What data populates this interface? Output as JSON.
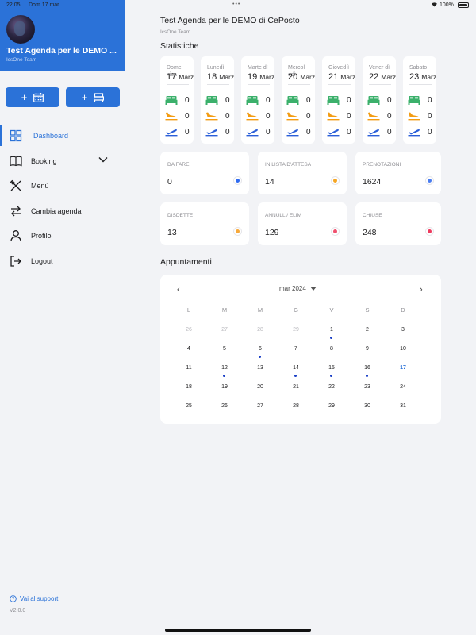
{
  "status_bar": {
    "time": "22:05",
    "date": "Dom 17 mar",
    "dots": "•••",
    "battery": "100%"
  },
  "sidebar": {
    "title": "Test Agenda per le DEMO ...",
    "subtitle": "IcsOne Team",
    "quick_actions": [
      {
        "label": "+",
        "icon": "calendar-icon"
      },
      {
        "label": "+",
        "icon": "bed-icon"
      }
    ],
    "items": [
      {
        "label": "Dashboard",
        "icon": "grid-icon",
        "active": true
      },
      {
        "label": "Booking",
        "icon": "book-icon"
      },
      {
        "label": "Menù",
        "icon": "utensils-icon"
      },
      {
        "label": "Cambia agenda",
        "icon": "swap-icon"
      },
      {
        "label": "Profilo",
        "icon": "user-icon"
      },
      {
        "label": "Logout",
        "icon": "logout-icon"
      }
    ],
    "support_label": "Vai al support",
    "version": "V2.0.0"
  },
  "main": {
    "title": "Test Agenda per le DEMO di CePosto",
    "subtitle": "IcsOne Team",
    "stats_heading": "Statistiche",
    "appointments_heading": "Appuntamenti"
  },
  "days": [
    {
      "name": "Dome nica",
      "day": "17",
      "month": "Marzo",
      "occupied": "0",
      "arrivals": "0",
      "departures": "0"
    },
    {
      "name": "Lunedì",
      "day": "18",
      "month": "Marzo",
      "occupied": "0",
      "arrivals": "0",
      "departures": "0"
    },
    {
      "name": "Marte dì",
      "day": "19",
      "month": "Marzo",
      "occupied": "0",
      "arrivals": "0",
      "departures": "0"
    },
    {
      "name": "Mercol edì",
      "day": "20",
      "month": "Marzo",
      "occupied": "0",
      "arrivals": "0",
      "departures": "0"
    },
    {
      "name": "Gioved ì",
      "day": "21",
      "month": "Marzo",
      "occupied": "0",
      "arrivals": "0",
      "departures": "0"
    },
    {
      "name": "Vener dì",
      "day": "22",
      "month": "Marzo",
      "occupied": "0",
      "arrivals": "0",
      "departures": "0"
    },
    {
      "name": "Sabato",
      "day": "23",
      "month": "Marzo",
      "occupied": "0",
      "arrivals": "0",
      "departures": "0"
    }
  ],
  "stats": [
    {
      "label": "DA FARE",
      "value": "0",
      "color": "#2f6bf0"
    },
    {
      "label": "IN LISTA D'ATTESA",
      "value": "14",
      "color": "#f5a623"
    },
    {
      "label": "PRENOTAZIONI",
      "value": "1624",
      "color": "#4a7df0"
    },
    {
      "label": "DISDETTE",
      "value": "13",
      "color": "#f7a93b"
    },
    {
      "label": "ANNULL / ELIM",
      "value": "129",
      "color": "#f0506e"
    },
    {
      "label": "CHIUSE",
      "value": "248",
      "color": "#ee3b5e"
    }
  ],
  "calendar": {
    "prev": "‹",
    "next": "›",
    "month_label": "mar 2024",
    "weekdays": [
      "L",
      "M",
      "M",
      "G",
      "V",
      "S",
      "D"
    ],
    "weeks": [
      [
        {
          "d": "26",
          "other": true
        },
        {
          "d": "27",
          "other": true
        },
        {
          "d": "28",
          "other": true
        },
        {
          "d": "29",
          "other": true
        },
        {
          "d": "1",
          "ev": true
        },
        {
          "d": "2"
        },
        {
          "d": "3"
        }
      ],
      [
        {
          "d": "4"
        },
        {
          "d": "5"
        },
        {
          "d": "6",
          "ev": true
        },
        {
          "d": "7"
        },
        {
          "d": "8"
        },
        {
          "d": "9"
        },
        {
          "d": "10"
        }
      ],
      [
        {
          "d": "11"
        },
        {
          "d": "12",
          "ev": true
        },
        {
          "d": "13"
        },
        {
          "d": "14",
          "ev": true
        },
        {
          "d": "15",
          "ev": true
        },
        {
          "d": "16",
          "ev": true
        },
        {
          "d": "17",
          "today": true
        }
      ],
      [
        {
          "d": "18"
        },
        {
          "d": "19"
        },
        {
          "d": "20"
        },
        {
          "d": "21"
        },
        {
          "d": "22"
        },
        {
          "d": "23"
        },
        {
          "d": "24"
        }
      ],
      [
        {
          "d": "25"
        },
        {
          "d": "26"
        },
        {
          "d": "27"
        },
        {
          "d": "28"
        },
        {
          "d": "29"
        },
        {
          "d": "30"
        },
        {
          "d": "31"
        }
      ]
    ]
  },
  "colors": {
    "accent": "#2b72d8",
    "bed": "#3bb06b",
    "arrival": "#f39c12",
    "departure": "#2b5fd8"
  }
}
